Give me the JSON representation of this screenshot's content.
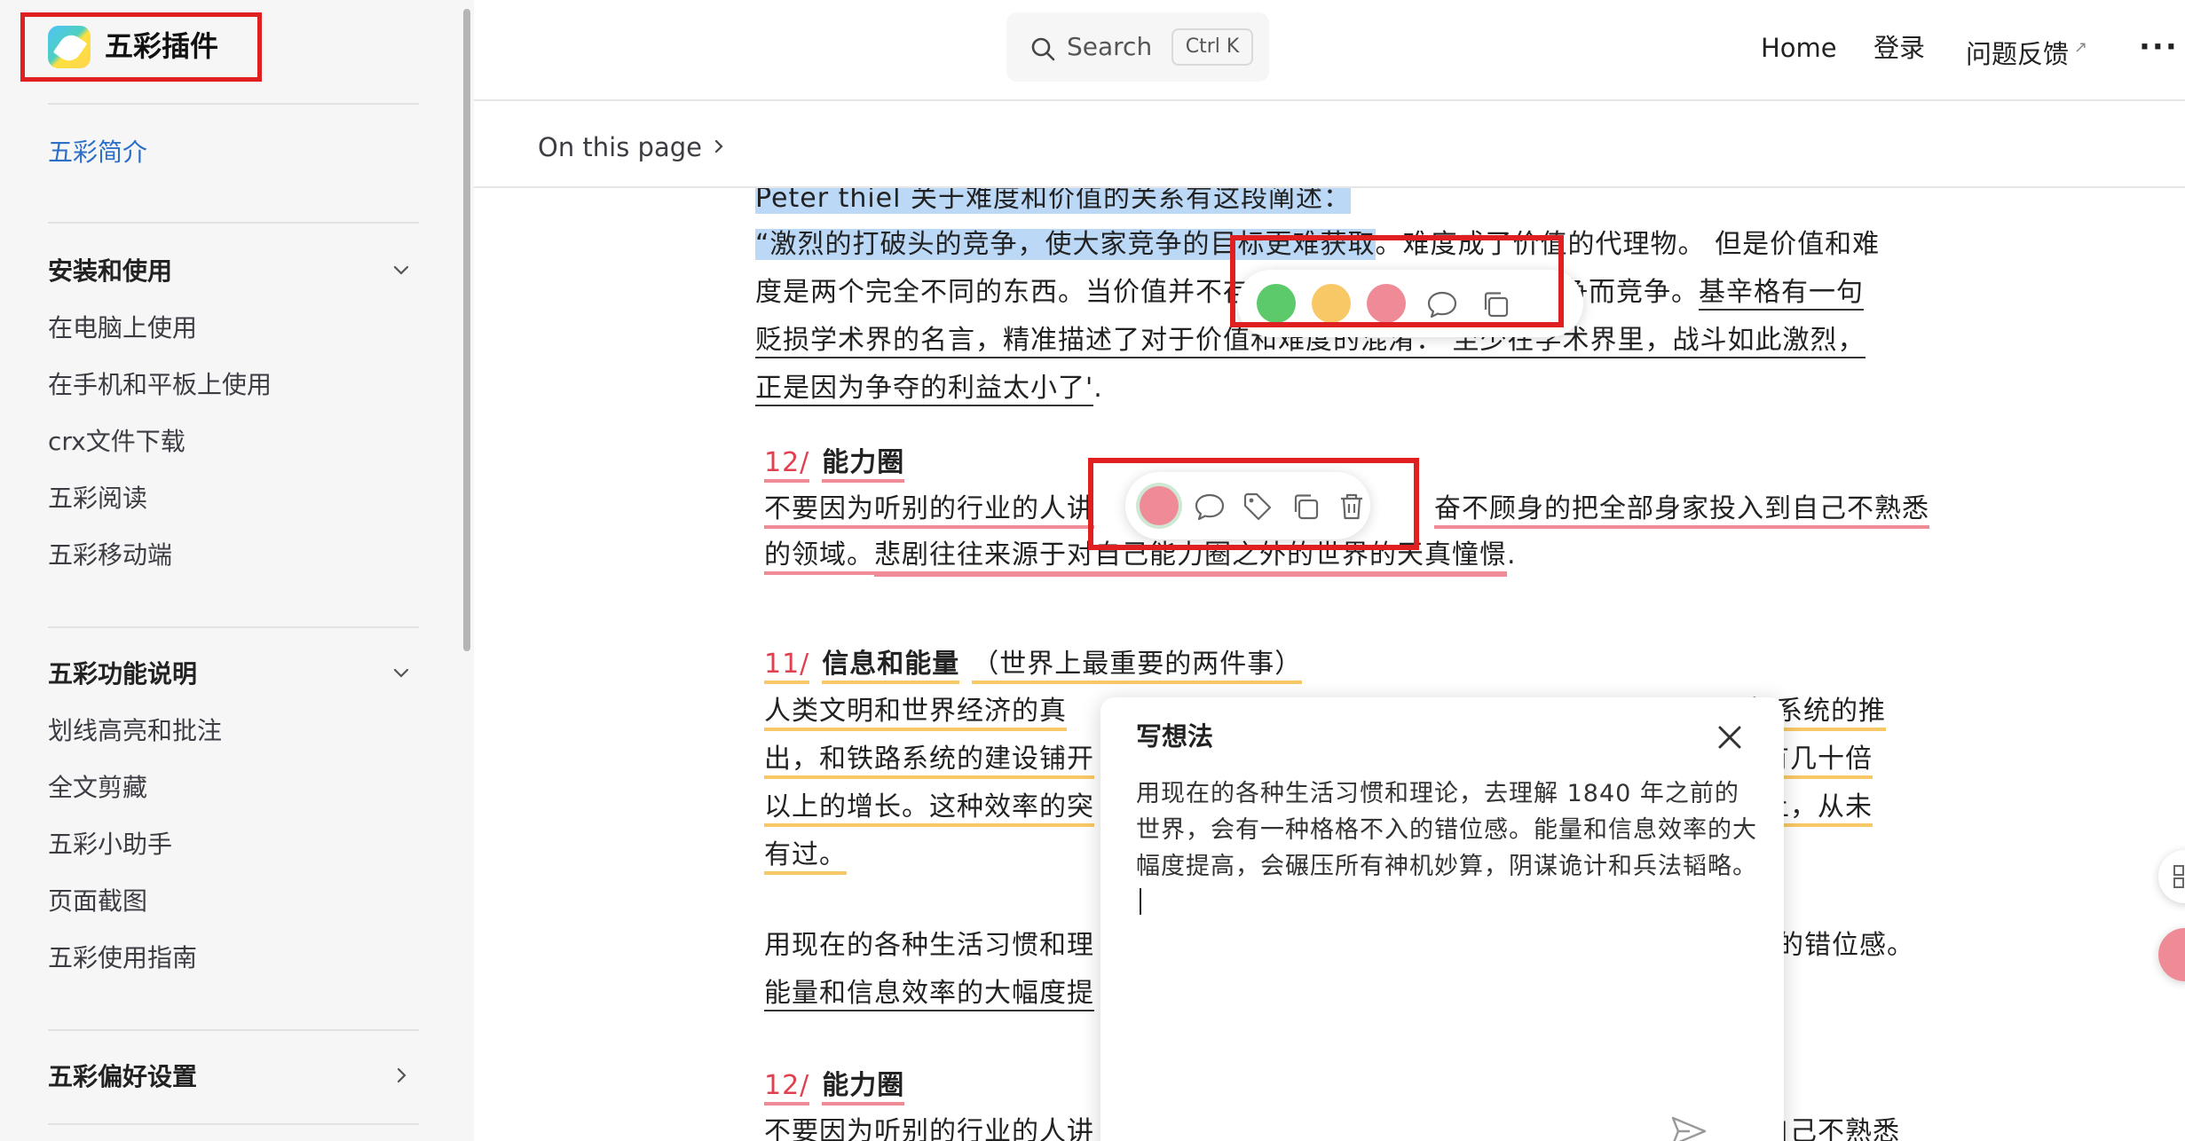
{
  "sidebar": {
    "logo_text": "五彩插件",
    "intro_link": "五彩简介",
    "groups": [
      {
        "title": "安装和使用",
        "items": [
          "在电脑上使用",
          "在手机和平板上使用",
          "crx文件下载",
          "五彩阅读",
          "五彩移动端"
        ]
      },
      {
        "title": "五彩功能说明",
        "items": [
          "划线高亮和批注",
          "全文剪藏",
          "五彩小助手",
          "页面截图",
          "五彩使用指南"
        ]
      },
      {
        "title": "五彩偏好设置",
        "items": []
      }
    ]
  },
  "topnav": {
    "search_placeholder": "Search",
    "search_shortcut": "Ctrl K",
    "home": "Home",
    "login": "登录",
    "feedback": "问题反馈",
    "more": "···"
  },
  "subbar": {
    "on_this_page": "On this page"
  },
  "content": {
    "p1": {
      "line0": "Peter thiel 关于难度和价值的关系有这段阐述：",
      "line1_hl": "“激烈的打破头的竞争，使大家竞争的目标更难获取",
      "line1_rest": "。难度成了价值的代理物。 但是价值和难",
      "line2_a": "度是两个完全不同的东西。当价值并不存",
      "line2_b": "了竞争而竞争。",
      "line2_c": "基辛格有一句",
      "line3": "贬损学术界的名言，精准描述了对于价值和难度的混淆：‘至少在学术界里，战斗如此激烈，",
      "line4": "正是因为争夺的利益太小了'",
      "line4_end": "."
    },
    "s12": {
      "num": "12/",
      "title": "能力圈",
      "line1_a": "不要因为听别的行业的人讲",
      "line1_b": "奋不顾身的把全部身家投入到自己不熟悉",
      "line2_a": "的领域。",
      "line2_b": "悲剧往往来源于对自己能力圈之外的世界的天真憧憬",
      "line2_end": "."
    },
    "s11": {
      "num": "11/",
      "title": "信息和能量",
      "subtitle": "（世界上最重要的两件事）",
      "line1_a": "人类文明和世界经济的真",
      "line1_b": "报系统的推",
      "line2_a": "出，和铁路系统的建设铺开",
      "line2_b": "都有几十倍",
      "line3_a": "以上的增长。这种效率的突",
      "line3_b": "史上，从未",
      "line4": "有过。"
    },
    "p_extra": {
      "line1_a": "用现在的各种生活习惯和理",
      "line1_b": "的错位感。",
      "line2": "能量和信息效率的大幅度提"
    },
    "s12b": {
      "num": "12/",
      "title": "能力圈",
      "line1_a": "不要因为听别的行业的人讲",
      "line1_b": "自己不熟悉"
    }
  },
  "note": {
    "title": "写想法",
    "text": "用现在的各种生活习惯和理论，去理解 1840 年之前的世界，会有一种格格不入的错位感。能量和信息效率的大幅度提高，会碾压所有神机妙算，阴谋诡计和兵法韬略。"
  },
  "colors": {
    "accent_blue": "#2c6fc7",
    "highlight_green": "#5cc96a",
    "highlight_yellow": "#f8c866",
    "highlight_red": "#ef8b96",
    "annotation_box": "#e02020"
  }
}
